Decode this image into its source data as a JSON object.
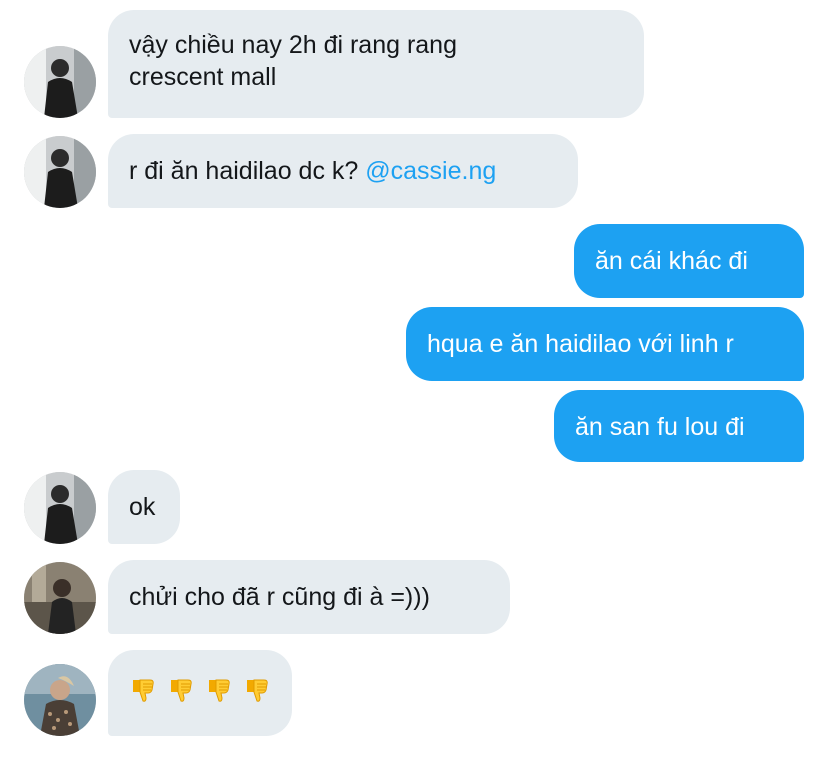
{
  "messages": [
    {
      "side": "in",
      "avatar": "avatar-dark-jacket",
      "text": "vậy chiều nay 2h đi rang rang\ncrescent mall"
    },
    {
      "side": "in",
      "avatar": "avatar-dark-jacket",
      "text": "r đi ăn haidilao dc k? ",
      "mention": "@cassie.ng"
    },
    {
      "side": "out",
      "text": "ăn cái khác đi"
    },
    {
      "side": "out",
      "text": "hqua e ăn haidilao với linh r"
    },
    {
      "side": "out",
      "text": "ăn san fu lou đi"
    },
    {
      "side": "in",
      "avatar": "avatar-dark-jacket",
      "text": "ok"
    },
    {
      "side": "in",
      "avatar": "avatar-street",
      "text": "chửi cho đã r cũng đi à =)))"
    },
    {
      "side": "in",
      "avatar": "avatar-patterned-jacket",
      "emoji": [
        "thumbs-down-emoji",
        "thumbs-down-emoji",
        "thumbs-down-emoji",
        "thumbs-down-emoji"
      ]
    }
  ],
  "colors": {
    "incoming_bubble": "#e6ecf0",
    "outgoing_bubble": "#1da1f2",
    "mention": "#1da1f2",
    "text_dark": "#14171a"
  }
}
